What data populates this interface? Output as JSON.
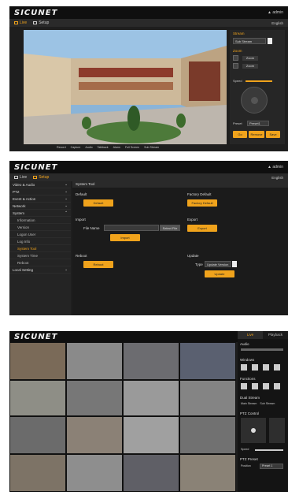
{
  "brand": {
    "logo": "SICUNET",
    "accent": "#f0a31c"
  },
  "panel1": {
    "user": "▲ admin",
    "right_label": "English",
    "tabs": [
      {
        "label": "Live"
      },
      {
        "label": "Setup"
      }
    ],
    "controls": {
      "stream_title": "Stream",
      "stream_value": "Sub Stream",
      "zoom_title": "Zoom",
      "zoom_in": "Zoom",
      "zoom_out": "Zoom",
      "speed_label": "Speed",
      "preset_label": "Preset",
      "preset_value": "Preset1",
      "buttons": [
        "Go",
        "Remove",
        "Save"
      ]
    },
    "bottom_bar": [
      "Record",
      "Capture",
      "Audio",
      "Talkback",
      "Alarm",
      "Full Screen",
      "Sub Stream"
    ]
  },
  "panel2": {
    "user": "▲ admin",
    "right_label": "English",
    "tabs": [
      {
        "label": "Live"
      },
      {
        "label": "Setup"
      }
    ],
    "breadcrumb": "System Tool",
    "sidebar": [
      {
        "label": "Video & Audio",
        "type": "group"
      },
      {
        "label": "PTZ",
        "type": "group"
      },
      {
        "label": "Event & Action",
        "type": "group"
      },
      {
        "label": "Network",
        "type": "group"
      },
      {
        "label": "System",
        "type": "group"
      },
      {
        "label": "Information",
        "type": "sub"
      },
      {
        "label": "Version",
        "type": "sub"
      },
      {
        "label": "Logon User",
        "type": "sub"
      },
      {
        "label": "Log Info",
        "type": "sub"
      },
      {
        "label": "System Tool",
        "type": "sub",
        "active": true
      },
      {
        "label": "System Time",
        "type": "sub"
      },
      {
        "label": "Reboot",
        "type": "sub"
      },
      {
        "label": "Local Setting",
        "type": "group"
      }
    ],
    "sections": {
      "default_title": "Default",
      "default_button": "Default",
      "factory_title": "Factory Default",
      "factory_button": "Factory Default",
      "import_title": "Import",
      "file_name_label": "File Name",
      "browse_button": "Select File",
      "import_button": "Import",
      "export_title": "Export",
      "export_button": "Export",
      "reboot_title": "Reboot",
      "reboot_button": "Reboot",
      "update_title": "Update",
      "type_label": "Type",
      "type_value": "Update Version",
      "update_button": "Update"
    }
  },
  "panel3": {
    "tabs": [
      "Live",
      "Playback"
    ],
    "panel_labels": {
      "audio": "Audio",
      "windows": "Windows",
      "functions": "Functions",
      "dual_stream": "Dual Stream",
      "main_stream": "Main Stream",
      "sub_stream": "Sub Stream",
      "ptz_control": "PTZ Control",
      "speed": "Speed",
      "ptz_preset": "PTZ Preset",
      "position": "Position",
      "position_value": "Preset 1"
    }
  }
}
